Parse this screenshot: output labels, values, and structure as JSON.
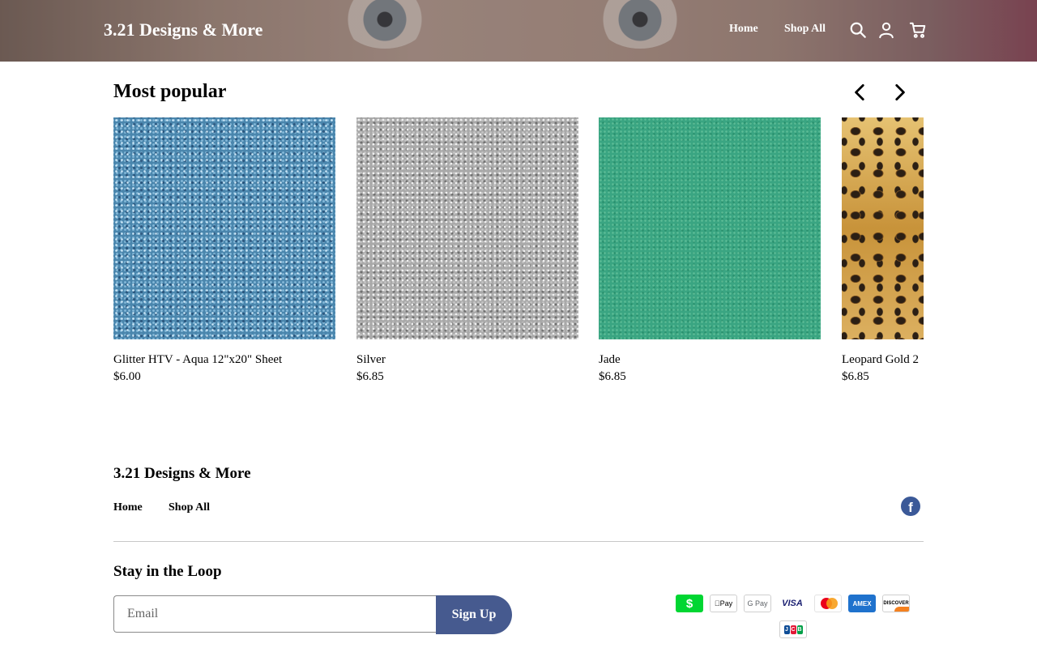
{
  "header": {
    "logo": "3.21 Designs & More",
    "nav": [
      {
        "label": "Home"
      },
      {
        "label": "Shop All"
      }
    ],
    "icons": [
      "search-icon",
      "account-icon",
      "cart-icon"
    ]
  },
  "popular": {
    "title": "Most popular",
    "products": [
      {
        "name": "Glitter HTV - Aqua 12\"x20\" Sheet",
        "price": "$6.00"
      },
      {
        "name": "Silver",
        "price": "$6.85"
      },
      {
        "name": "Jade",
        "price": "$6.85"
      },
      {
        "name": "Leopard Gold 2",
        "price": "$6.85"
      }
    ]
  },
  "footer": {
    "brand": "3.21 Designs & More",
    "links": [
      {
        "label": "Home"
      },
      {
        "label": "Shop All"
      }
    ],
    "social": "facebook-icon",
    "newsletter": {
      "title": "Stay in the Loop",
      "email_placeholder": "Email",
      "button_label": "Sign Up"
    },
    "payments": {
      "cashapp": "$",
      "applepay": "Pay",
      "googlepay": "G Pay",
      "visa": "VISA",
      "amex": "AMEX",
      "discover": "DISCOVER",
      "jcb": [
        "J",
        "C",
        "B"
      ]
    }
  },
  "colors": {
    "accent": "#465a8f",
    "facebook": "#3b5998",
    "cashapp": "#00d632"
  }
}
